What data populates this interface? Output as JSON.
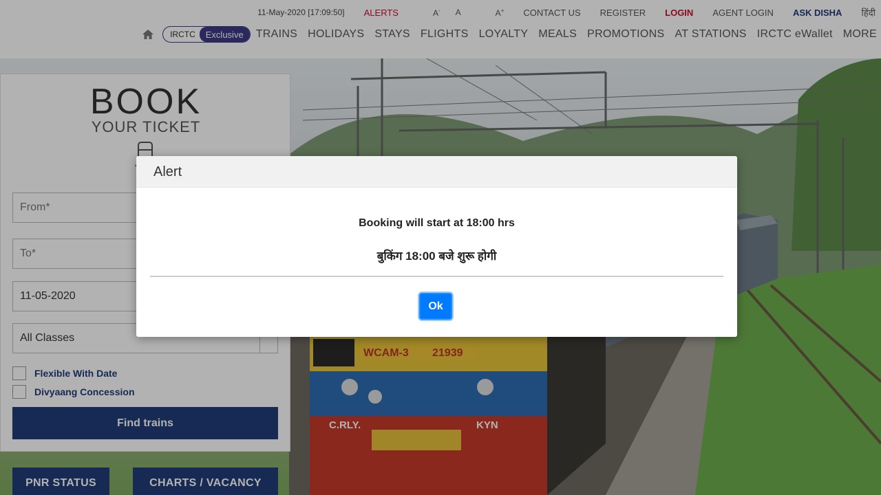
{
  "topbar": {
    "datetime": "11-May-2020 [17:09:50]",
    "alerts": "ALERTS",
    "font_small": "A",
    "font_small_sup": "-",
    "font_normal": "A",
    "font_large": "A",
    "font_large_sup": "+",
    "contact": "CONTACT US",
    "register": "REGISTER",
    "login": "LOGIN",
    "agent_login": "AGENT LOGIN",
    "ask_disha": "ASK DISHA",
    "hindi": "हिंदी"
  },
  "nav": {
    "badge_left": "IRCTC",
    "badge_right": "Exclusive",
    "items": [
      "TRAINS",
      "HOLIDAYS",
      "STAYS",
      "FLIGHTS",
      "LOYALTY",
      "MEALS",
      "PROMOTIONS",
      "AT STATIONS",
      "IRCTC eWallet",
      "MORE"
    ]
  },
  "booking": {
    "title": "BOOK",
    "subtitle": "YOUR TICKET",
    "from_placeholder": "From*",
    "to_placeholder": "To*",
    "date_value": "11-05-2020",
    "class_value": "All Classes",
    "flexible_label": "Flexible With Date",
    "divyaang_label": "Divyaang Concession",
    "find_button": "Find trains",
    "pnr_button": "PNR STATUS",
    "charts_button": "CHARTS / VACANCY"
  },
  "modal": {
    "title": "Alert",
    "message_en": "Booking will start at 18:00 hrs",
    "message_hi": "बुकिंग 18:00 बजे शुरू होगी",
    "ok_button": "Ok"
  },
  "hero": {
    "engine_text": "WCAM-3",
    "engine_number": "21939",
    "left_plate": "C.RLY.",
    "right_plate": "KYN"
  },
  "colors": {
    "brand_navy": "#213d77",
    "alert_red": "#c8102e",
    "ok_blue": "#007bff"
  }
}
